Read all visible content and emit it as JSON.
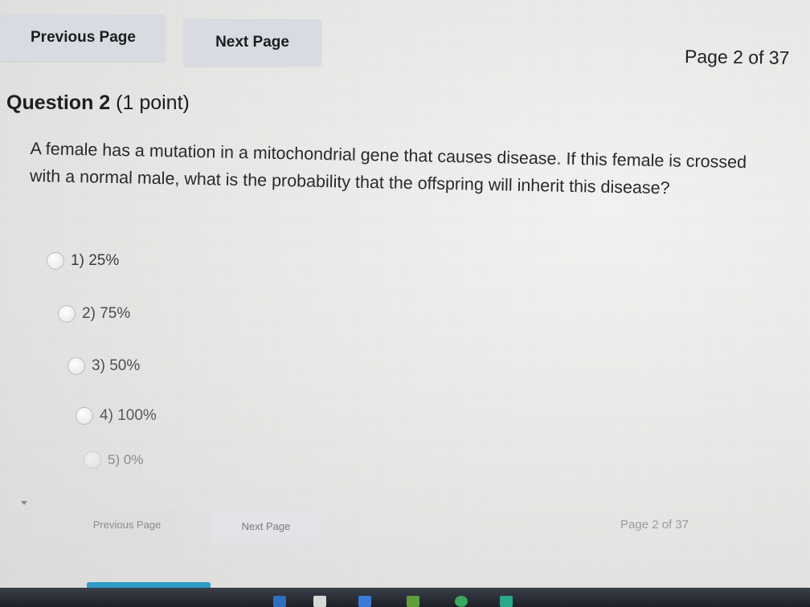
{
  "nav": {
    "previous_label": "Previous Page",
    "next_label": "Next Page",
    "page_indicator": "Page 2 of 37"
  },
  "question": {
    "name": "Question 2",
    "points": "(1 point)",
    "text": "A female has a mutation in a mitochondrial gene that causes disease. If this female is crossed with a normal male, what is the probability that the offspring will inherit this disease?",
    "options": [
      {
        "number": "1)",
        "label": "25%"
      },
      {
        "number": "2)",
        "label": "75%"
      },
      {
        "number": "3)",
        "label": "50%"
      },
      {
        "number": "4)",
        "label": "100%"
      },
      {
        "number": "5)",
        "label": "0%"
      }
    ]
  },
  "bottom_nav": {
    "previous_label": "Previous Page",
    "next_label": "Next Page",
    "page_indicator": "Page 2 of 37"
  },
  "colors": {
    "button_bg": "#d8dce2",
    "taskbar": "#1d2027",
    "progress": "#2e9cc4"
  }
}
